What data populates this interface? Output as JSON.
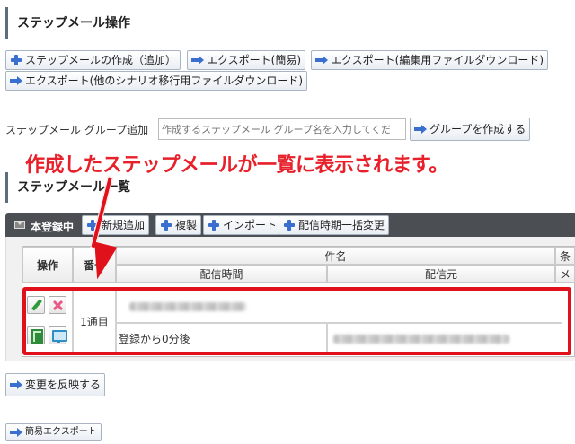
{
  "sections": {
    "operations_title": "ステップメール操作",
    "list_title": "ステップメール一覧"
  },
  "toolbar": [
    {
      "label": "ステップメールの作成（追加）",
      "icon": "plus-icon"
    },
    {
      "label": "エクスポート(簡易)",
      "icon": "arrow-icon"
    },
    {
      "label": "エクスポート(編集用ファイルダウンロード)",
      "icon": "arrow-icon"
    },
    {
      "label": "エクスポート(他のシナリオ移行用ファイルダウンロード)",
      "icon": "arrow-icon"
    }
  ],
  "group_form": {
    "label": "ステップメール グループ追加",
    "placeholder": "作成するステップメール グループ名を入力してくだ",
    "button": "グループを作成する"
  },
  "annotation": "作成したステップメールが一覧に表示されます。",
  "panel": {
    "title": "本登録中",
    "buttons": [
      "新規追加",
      "複製",
      "インポート",
      "配信時期一括変更"
    ]
  },
  "table": {
    "headers": {
      "action": "操作",
      "number": "番号",
      "subject": "件名",
      "delivery_time": "配信時間",
      "sender": "配信元",
      "condition_partial": "条",
      "extra_partial": "メ"
    },
    "rows": [
      {
        "number": "1通目",
        "delivery_time": "登録から0分後"
      }
    ]
  },
  "footer": {
    "apply_button": "変更を反映する",
    "simple_export": "簡易エクスポート"
  },
  "colors": {
    "annotation": "#e8202a",
    "panel_bar": "#4b4f54",
    "accent_icon": "#3b6fcf"
  }
}
